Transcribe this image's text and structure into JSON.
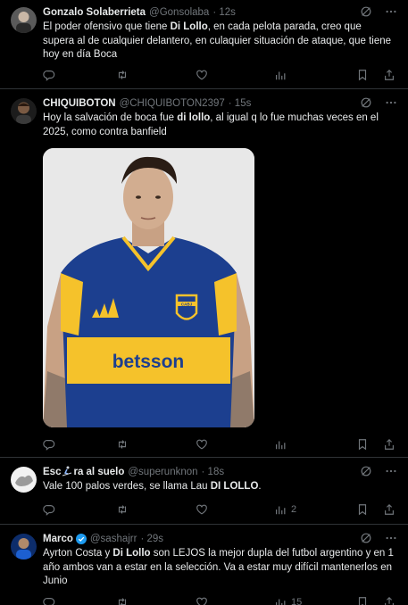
{
  "posts": [
    {
      "name": "Gonzalo Solaberrieta",
      "handle": "@Gonsolaba",
      "time": "· 12s",
      "text_segments": [
        {
          "t": "El poder ofensivo que tiene ",
          "bold": false
        },
        {
          "t": "Di Lollo",
          "bold": true
        },
        {
          "t": ", en cada pelota parada, creo que supera al de cualquier delantero, en culaquier situación de ataque, que tiene hoy en día Boca",
          "bold": false
        }
      ],
      "views": ""
    },
    {
      "name": "CHIQUIBOTON",
      "handle": "@CHIQUIBOTON2397",
      "time": "· 15s",
      "text_segments": [
        {
          "t": "Hoy la salvación de boca fue ",
          "bold": false
        },
        {
          "t": "di lollo",
          "bold": true
        },
        {
          "t": ", al igual q lo fue muchas veces en el 2025, como contra banfield",
          "bold": false
        }
      ],
      "media": {
        "jersey_text": "betsson",
        "badge_text": "CABJ"
      },
      "views": ""
    },
    {
      "name": "Esc",
      "name_suffix": "ra al suelo",
      "handle": "@superunknon",
      "time": "· 18s",
      "text_segments": [
        {
          "t": "Vale 100 palos verdes, se llama Lau ",
          "bold": false
        },
        {
          "t": "DI LOLLO",
          "bold": true
        },
        {
          "t": ".",
          "bold": false
        }
      ],
      "views": "2"
    },
    {
      "name": "Marco",
      "verified": true,
      "handle": "@sashajrr",
      "time": "· 29s",
      "text_segments": [
        {
          "t": "Ayrton Costa y ",
          "bold": false
        },
        {
          "t": "Di Lollo",
          "bold": true
        },
        {
          "t": " son LEJOS la mejor dupla del futbol argentino y en 1 año ambos van a estar en la selección. Va a estar muy difícil mantenerlos en Junio",
          "bold": false
        }
      ],
      "views": "15"
    }
  ],
  "colors": {
    "background": "#000000",
    "text": "#e7e9ea",
    "muted": "#71767b",
    "divider": "#2f3336",
    "verified": "#1d9bf0"
  }
}
